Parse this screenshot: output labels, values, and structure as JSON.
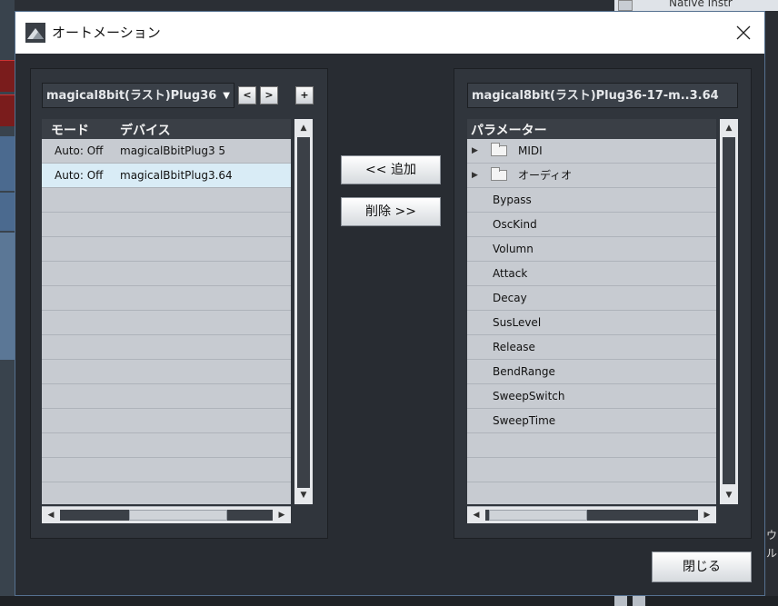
{
  "dialog": {
    "title": "オートメーション",
    "close_glyph": "✕"
  },
  "left": {
    "device_select": "magical8bit(ラスト)Plug36",
    "prev_label": "<",
    "next_label": ">",
    "add_label": "+",
    "columns": [
      "モード",
      "デバイス"
    ],
    "rows": [
      {
        "mode": "Auto: Off",
        "device": "magicalBbitPlug3 5"
      },
      {
        "mode": "Auto: Off",
        "device": "magicalBbitPlug3.64"
      }
    ]
  },
  "middle": {
    "add_button": "<< 追加",
    "remove_button": "削除 >>"
  },
  "right": {
    "device_label": "magical8bit(ラスト)Plug36-17-m..3.64",
    "column": "パラメーター",
    "folders": [
      "MIDI",
      "オーディオ"
    ],
    "params": [
      "Bypass",
      "OscKind",
      "Volumn",
      "Attack",
      "Decay",
      "SusLevel",
      "Release",
      "BendRange",
      "SweepSwitch",
      "SweepTime"
    ]
  },
  "footer": {
    "close_button": "閉じる"
  },
  "background": {
    "top_text": "Native Instr",
    "right_glyphs": [
      "ウ",
      "ル"
    ]
  }
}
